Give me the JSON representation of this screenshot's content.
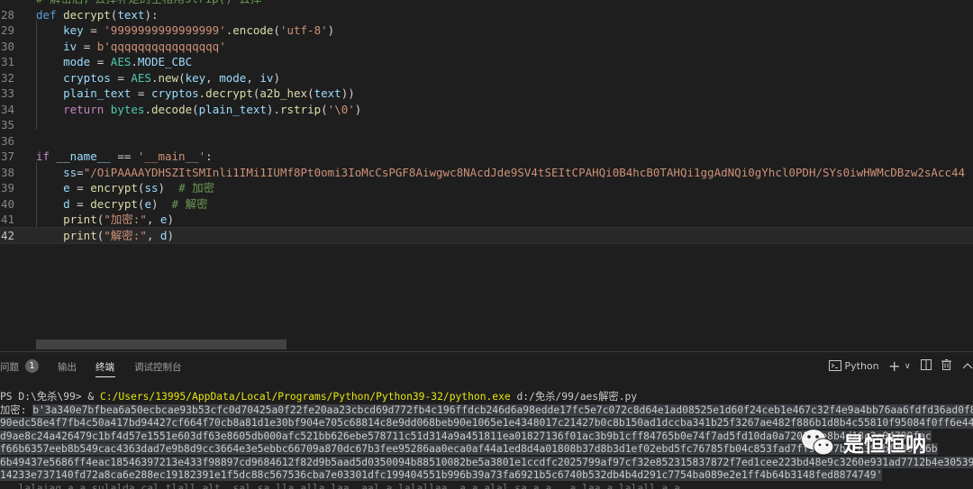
{
  "editor": {
    "lines": [
      {
        "num": "",
        "tokens": [
          {
            "t": "# 解密后，去掉补足的空格用strip() 去掉",
            "c": "cm"
          }
        ]
      },
      {
        "num": "28",
        "tokens": [
          {
            "t": "def ",
            "c": "kw"
          },
          {
            "t": "decrypt",
            "c": "fn"
          },
          {
            "t": "(",
            "c": "op"
          },
          {
            "t": "text",
            "c": "var"
          },
          {
            "t": "):",
            "c": "op"
          }
        ]
      },
      {
        "num": "29",
        "tokens": [
          {
            "t": "    ",
            "c": "op"
          },
          {
            "t": "key",
            "c": "var"
          },
          {
            "t": " = ",
            "c": "op"
          },
          {
            "t": "'9999999999999999'",
            "c": "str"
          },
          {
            "t": ".",
            "c": "op"
          },
          {
            "t": "encode",
            "c": "fn"
          },
          {
            "t": "(",
            "c": "op"
          },
          {
            "t": "'utf-8'",
            "c": "str"
          },
          {
            "t": ")",
            "c": "op"
          }
        ]
      },
      {
        "num": "30",
        "tokens": [
          {
            "t": "    ",
            "c": "op"
          },
          {
            "t": "iv",
            "c": "var"
          },
          {
            "t": " = ",
            "c": "op"
          },
          {
            "t": "b'qqqqqqqqqqqqqqqq'",
            "c": "str"
          }
        ]
      },
      {
        "num": "31",
        "tokens": [
          {
            "t": "    ",
            "c": "op"
          },
          {
            "t": "mode",
            "c": "var"
          },
          {
            "t": " = ",
            "c": "op"
          },
          {
            "t": "AES",
            "c": "cls"
          },
          {
            "t": ".",
            "c": "op"
          },
          {
            "t": "MODE_CBC",
            "c": "var"
          }
        ]
      },
      {
        "num": "32",
        "tokens": [
          {
            "t": "    ",
            "c": "op"
          },
          {
            "t": "cryptos",
            "c": "var"
          },
          {
            "t": " = ",
            "c": "op"
          },
          {
            "t": "AES",
            "c": "cls"
          },
          {
            "t": ".",
            "c": "op"
          },
          {
            "t": "new",
            "c": "fn"
          },
          {
            "t": "(",
            "c": "op"
          },
          {
            "t": "key",
            "c": "var"
          },
          {
            "t": ", ",
            "c": "op"
          },
          {
            "t": "mode",
            "c": "var"
          },
          {
            "t": ", ",
            "c": "op"
          },
          {
            "t": "iv",
            "c": "var"
          },
          {
            "t": ")",
            "c": "op"
          }
        ]
      },
      {
        "num": "33",
        "tokens": [
          {
            "t": "    ",
            "c": "op"
          },
          {
            "t": "plain_text",
            "c": "var"
          },
          {
            "t": " = ",
            "c": "op"
          },
          {
            "t": "cryptos",
            "c": "var"
          },
          {
            "t": ".",
            "c": "op"
          },
          {
            "t": "decrypt",
            "c": "fn"
          },
          {
            "t": "(",
            "c": "op"
          },
          {
            "t": "a2b_hex",
            "c": "fn"
          },
          {
            "t": "(",
            "c": "op"
          },
          {
            "t": "text",
            "c": "var"
          },
          {
            "t": "))",
            "c": "op"
          }
        ]
      },
      {
        "num": "34",
        "tokens": [
          {
            "t": "    ",
            "c": "op"
          },
          {
            "t": "return ",
            "c": "kwc"
          },
          {
            "t": "bytes",
            "c": "cls"
          },
          {
            "t": ".",
            "c": "op"
          },
          {
            "t": "decode",
            "c": "fn"
          },
          {
            "t": "(",
            "c": "op"
          },
          {
            "t": "plain_text",
            "c": "var"
          },
          {
            "t": ").",
            "c": "op"
          },
          {
            "t": "rstrip",
            "c": "fn"
          },
          {
            "t": "(",
            "c": "op"
          },
          {
            "t": "'\\0'",
            "c": "str"
          },
          {
            "t": ")",
            "c": "op"
          }
        ]
      },
      {
        "num": "35",
        "tokens": []
      },
      {
        "num": "36",
        "tokens": []
      },
      {
        "num": "37",
        "tokens": [
          {
            "t": "if ",
            "c": "kwc"
          },
          {
            "t": "__name__",
            "c": "var"
          },
          {
            "t": " == ",
            "c": "op"
          },
          {
            "t": "'__main__'",
            "c": "str"
          },
          {
            "t": ":",
            "c": "op"
          }
        ]
      },
      {
        "num": "38",
        "tokens": [
          {
            "t": "    ",
            "c": "op"
          },
          {
            "t": "ss",
            "c": "var"
          },
          {
            "t": "=",
            "c": "op"
          },
          {
            "t": "\"/OiPAAAAYDHSZItSMInli1IMi1IUMf8Pt0omi3IoMcCsPGF8Aiwgwc8NAcdJde9SV4tSEItCPAHQi0B4hcB0TAHQi1ggAdNQi0gYhcl0PDH/SYs0iwHWMcDBzw2sAcc44",
            "c": "str"
          }
        ]
      },
      {
        "num": "39",
        "tokens": [
          {
            "t": "    ",
            "c": "op"
          },
          {
            "t": "e",
            "c": "var"
          },
          {
            "t": " = ",
            "c": "op"
          },
          {
            "t": "encrypt",
            "c": "fn"
          },
          {
            "t": "(",
            "c": "op"
          },
          {
            "t": "ss",
            "c": "var"
          },
          {
            "t": ")  ",
            "c": "op"
          },
          {
            "t": "# 加密",
            "c": "cm"
          }
        ]
      },
      {
        "num": "40",
        "tokens": [
          {
            "t": "    ",
            "c": "op"
          },
          {
            "t": "d",
            "c": "var"
          },
          {
            "t": " = ",
            "c": "op"
          },
          {
            "t": "decrypt",
            "c": "fn"
          },
          {
            "t": "(",
            "c": "op"
          },
          {
            "t": "e",
            "c": "var"
          },
          {
            "t": ")  ",
            "c": "op"
          },
          {
            "t": "# 解密",
            "c": "cm"
          }
        ]
      },
      {
        "num": "41",
        "tokens": [
          {
            "t": "    ",
            "c": "op"
          },
          {
            "t": "print",
            "c": "fn"
          },
          {
            "t": "(",
            "c": "op"
          },
          {
            "t": "\"加密:\"",
            "c": "str"
          },
          {
            "t": ", ",
            "c": "op"
          },
          {
            "t": "e",
            "c": "var"
          },
          {
            "t": ")",
            "c": "op"
          }
        ]
      },
      {
        "num": "42",
        "tokens": [
          {
            "t": "    ",
            "c": "op"
          },
          {
            "t": "print",
            "c": "fn"
          },
          {
            "t": "(",
            "c": "op"
          },
          {
            "t": "\"解密:\"",
            "c": "str"
          },
          {
            "t": ", ",
            "c": "op"
          },
          {
            "t": "d",
            "c": "var"
          },
          {
            "t": ")",
            "c": "op"
          }
        ]
      }
    ],
    "current_line": "42"
  },
  "panel": {
    "tabs": {
      "problems": "问题",
      "problems_count": "1",
      "output": "输出",
      "terminal": "终端",
      "debug_console": "调试控制台"
    },
    "terminal_profile": "Python",
    "actions": {
      "add": "+",
      "dropdown": "∨",
      "split": "◫",
      "trash": "🗑",
      "maximize": "︿"
    }
  },
  "terminal": {
    "prompt": "PS D:\\免杀\\99> & ",
    "python_path": "C:/Users/13995/AppData/Local/Programs/Python/Python39-32/python.exe",
    "script_arg": " d:/免杀/99/aes解密.py",
    "encrypt_label": "加密: ",
    "encrypt_lines": [
      "b'3a340e7bfbea6a50ecbcae93b53cfc0d70425a0f22fe20aa23cbcd69d772fb4c196ffdcb246d6a98edde17fc5e7c072c8d64e1ad08525e1d60f24ceb1e467c32f4e9a4bb76aa6fdfd36ad0f8136",
      "90edc58e4f7fb4c50a417bd94427cf664f70cb8a81d1e30bf904e705c68814c8e9dd068beb90e1065e1e4348017c21427b0c8b150ad1dccba341b25f3267ae482f886b1d8b4c55810f95084f0ff6e449db1",
      "d9ae8c24a426479c1bf4d57e1551e603df63e8605db000afc521bb626ebe578711c51d314a9a451811ea01827136f01ac3b9b1cff84765b0e74f7ad5fd10da0a72012fe8b4d18c2e84799fac",
      "f66b6357eeb8b549cac4363dad7e9b8d9cc3664e3e5ebbc66709a870dc67b3fee95286aa0eca0af44a1ed8d4a01808b37d8b3d1ef02ebd5fc76785fb04c853fad7ff9b2a7b4f6397bf739746b",
      "6b49437e5686ff4eac18546397213e433f98897cd9684612f82d9b5aad5d0350094b88510082be5a3801e1ccdfc2025799af97cf32e852315837872f7ed1cee223bd48e9c3260e931ad7712b4e30539cfc",
      "14233e737140fd72a8ca6e288ec19182391e1f5dc88c567536cba7e03301dfc199404551b996b39a73fa6921b5c6740b532db4b4d291c7754ba089e2e1ff4b64b3148fed8874749'",
      "   lalaiaq a a sulalda cal tlall alt  sal sa lla alla laa  aal a lalallaa  a a alal sa a a   a laa a lalall a a"
    ]
  },
  "watermark": {
    "text": "是恒恒呐"
  }
}
